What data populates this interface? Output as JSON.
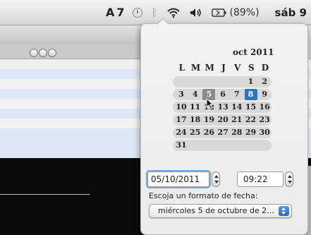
{
  "menubar": {
    "adobe_label": "A",
    "creative_count": "7",
    "battery_percent": "(89%)",
    "date_partial": "sáb 9"
  },
  "calendar": {
    "month_title": "oct 2011",
    "weekdays": [
      "L",
      "M",
      "M",
      "J",
      "V",
      "S",
      "D"
    ],
    "weeks": [
      [
        "",
        "",
        "",
        "",
        "",
        "1",
        "2"
      ],
      [
        "3",
        "4",
        "5",
        "6",
        "7",
        "8",
        "9"
      ],
      [
        "10",
        "11",
        "12",
        "13",
        "14",
        "15",
        "16"
      ],
      [
        "17",
        "18",
        "19",
        "20",
        "21",
        "22",
        "23"
      ],
      [
        "24",
        "25",
        "26",
        "27",
        "28",
        "29",
        "30"
      ],
      [
        "31",
        "",
        "",
        "",
        "",
        "",
        ""
      ]
    ],
    "selected_day": "5",
    "today_day": "8"
  },
  "date_field": {
    "value": "05/10/2011"
  },
  "time_field": {
    "value": "09:22"
  },
  "format": {
    "label": "Escoja un formato de fecha:",
    "selected": "miércoles 5 de octubre de 2..."
  },
  "colors": {
    "today": "#2f73c8",
    "selected": "#8a8a8a",
    "focus_ring": "#7aa7e0"
  }
}
